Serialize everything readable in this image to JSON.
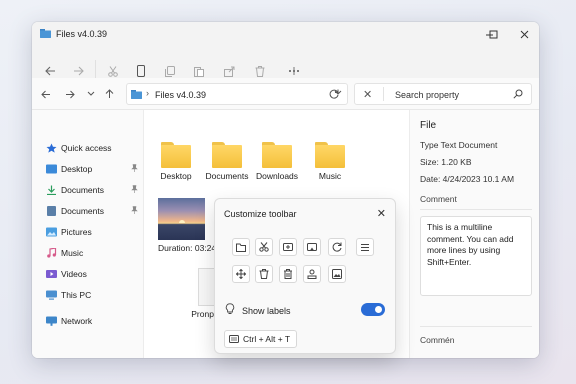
{
  "window": {
    "title": "Files v4.0.39",
    "controls": {
      "minimize": "—",
      "maximize": "☐",
      "close": "✕"
    }
  },
  "toolbar": {
    "buttons": [
      "back-icon",
      "forward-icon",
      "cut-icon",
      "phone-icon",
      "copy-icon",
      "paste-icon",
      "share-icon",
      "delete-icon",
      "more-icon"
    ]
  },
  "address": {
    "chevron": "›",
    "path": "Files v4.0.39",
    "dropdown": "⌄"
  },
  "search": {
    "placeholder": "Search property",
    "clear": "✕"
  },
  "sidebar": {
    "items": [
      {
        "label": "Quick access",
        "icon": "star-icon",
        "pinned": false
      },
      {
        "label": "Desktop",
        "icon": "desktop-icon",
        "pinned": true
      },
      {
        "label": "Documents",
        "icon": "download-icon",
        "pinned": true
      },
      {
        "label": "Documents",
        "icon": "documents-icon",
        "pinned": true
      },
      {
        "label": "Pictures",
        "icon": "pictures-icon",
        "pinned": false
      },
      {
        "label": "Music",
        "icon": "music-icon",
        "pinned": false
      },
      {
        "label": "Videos",
        "icon": "videos-icon",
        "pinned": false
      },
      {
        "label": "This PC",
        "icon": "pc-icon",
        "pinned": false
      },
      {
        "label": "Network",
        "icon": "network-icon",
        "pinned": false
      }
    ],
    "pin": "📌"
  },
  "files": {
    "folders": [
      "Desktop",
      "Documents",
      "Downloads",
      "Music"
    ],
    "image1": "Duration: 03:24",
    "doc": "Pronperties"
  },
  "properties": {
    "heading": "File",
    "type": "Type Text Document",
    "size": "Size: 1.20 KB",
    "date": "Date: 4/24/2023 10.1 AM",
    "comment_label": "Comment",
    "comment_text": "This is a multiline comment. You can add more lines by using Shift+Enter.",
    "footer_label": "Commén"
  },
  "popup": {
    "title": "Customize toolbar",
    "close": "✕",
    "row1": [
      "folder-icon",
      "cut-icon",
      "copy-icon",
      "paste-icon",
      "refresh-icon",
      "menu-icon"
    ],
    "row2": [
      "move-icon",
      "delete-icon",
      "trash-icon",
      "upload-icon",
      "gallery-icon"
    ],
    "show_labels": "Show labels",
    "show_labels_on": true,
    "shortcut": "Ctrl + Alt + T"
  },
  "colors": {
    "accent": "#2a6cd6",
    "folder": "#f4bf3a"
  }
}
